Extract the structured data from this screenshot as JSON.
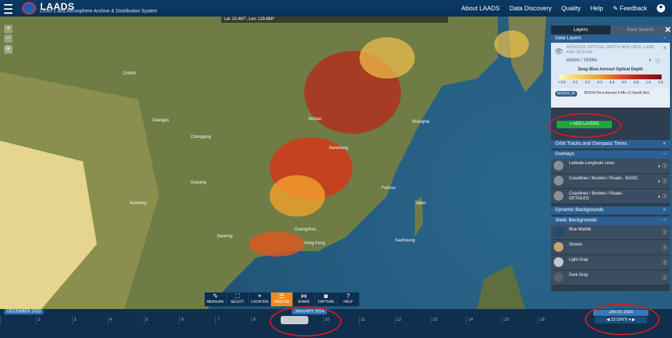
{
  "header": {
    "brand_title": "LAADS",
    "brand_subtitle": "Level-1 and Atmosphere Archive & Distribution System",
    "nav": [
      "About LAADS",
      "Data Discovery",
      "Quality",
      "Help",
      "Feedback"
    ]
  },
  "map": {
    "coords": "Lat: 23.467°, Lon: 129.888°",
    "labels": [
      {
        "id": "china",
        "text": "CHINA"
      },
      {
        "id": "shanghai",
        "text": "Shanghai"
      },
      {
        "id": "wuhan",
        "text": "Wuhan"
      },
      {
        "id": "nanchang",
        "text": "Nanchang"
      },
      {
        "id": "fuzhou",
        "text": "Fuzhou"
      },
      {
        "id": "guangzhou",
        "text": "Guangzhou"
      },
      {
        "id": "hongkong",
        "text": "Hong Kong"
      },
      {
        "id": "kaohsiung",
        "text": "Kaohsiung"
      },
      {
        "id": "taipei",
        "text": "Taipei"
      },
      {
        "id": "chengdu",
        "text": "Chengdu"
      },
      {
        "id": "chongqing",
        "text": "Chongqing"
      },
      {
        "id": "kunming",
        "text": "Kunming"
      },
      {
        "id": "guiyang",
        "text": "Guiyang"
      },
      {
        "id": "nanning",
        "text": "Nanning"
      }
    ]
  },
  "panel": {
    "tabs": [
      "Layers",
      "Data Search"
    ],
    "data_layers_title": "Data Layers",
    "layer_name": "AEROSOL OPTICAL DEPTH 3KM (3KM, LAND AND OCEAN)",
    "layer_source": "MODIS / TERRA",
    "legend_title": "Deep Blue Aerosol Optical Depth",
    "legend_ticks": [
      "< 0.0",
      "0.1",
      "0.2",
      "0.3",
      "0.4",
      "0.5",
      "0.8",
      "1.0",
      "5.0"
    ],
    "product_badge": "MOD04_3K",
    "product_desc": "MODIS/Terra Aerosol 5-Min L2 Swath 3km",
    "add_layers": "+ ADD LAYERS",
    "orbit_tracks": "Orbit Tracks and Overpass Times",
    "overlays_title": "Overlays",
    "overlays": [
      "Latitude-Longitude Lines",
      "Coastlines / Borders / Roads - BASIC",
      "Coastlines / Borders / Roads - DETAILED"
    ],
    "dynamic_title": "Dynamic Backgrounds",
    "static_title": "Static Backgrounds",
    "static": [
      "Blue Marble",
      "Streets",
      "Light Gray",
      "Dark Gray"
    ]
  },
  "toolbar": [
    "MEASURE",
    "SELECT",
    "LOCATION",
    "TIMELINE",
    "SHARE",
    "CAPTURE",
    "HELP"
  ],
  "timeline": {
    "month_left": "DECEMBER 2023",
    "month_center": "JANUARY 2024",
    "current_date": "JAN 01 2024",
    "range": "23 DAYS",
    "ticks": [
      "",
      "2",
      "3",
      "4",
      "5",
      "6",
      "7",
      "8",
      "9",
      "10",
      "11",
      "12",
      "13",
      "14",
      "15",
      "16"
    ]
  },
  "colors": {
    "accent": "#f28a21",
    "header": "#0b3a66",
    "highlight": "#d21d1d"
  }
}
